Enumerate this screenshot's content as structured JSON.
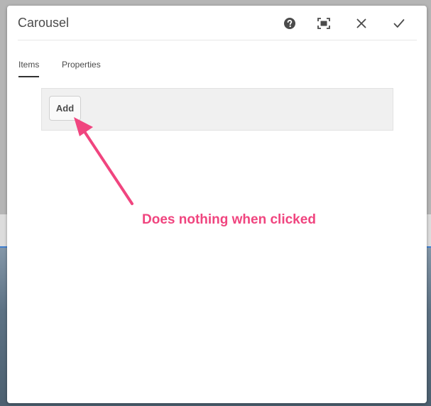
{
  "dialog": {
    "title": "Carousel",
    "header_icons": [
      "help-icon",
      "fullscreen-icon",
      "close-icon",
      "check-icon"
    ]
  },
  "tabs": [
    {
      "label": "Items",
      "active": true
    },
    {
      "label": "Properties",
      "active": false
    }
  ],
  "multifield": {
    "add_label": "Add"
  },
  "annotation": {
    "text": "Does nothing when clicked",
    "color": "#f0457f"
  }
}
